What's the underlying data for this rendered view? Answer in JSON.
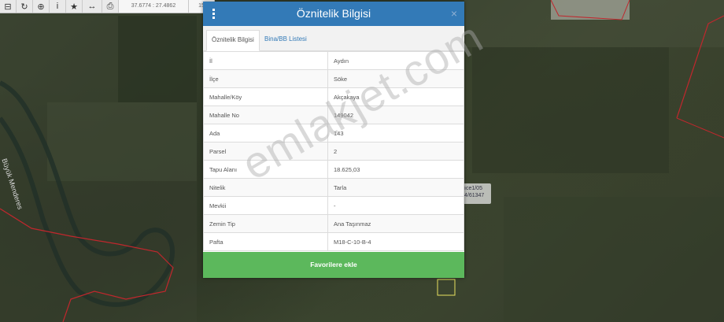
{
  "toolbar": {
    "buttons": [
      {
        "icon": "menu-icon",
        "glyph": "⊟"
      },
      {
        "icon": "refresh-icon",
        "glyph": "↻"
      },
      {
        "icon": "crosshair-icon",
        "glyph": "⊕"
      },
      {
        "icon": "info-icon",
        "glyph": "i"
      },
      {
        "icon": "star-icon",
        "glyph": "★"
      },
      {
        "icon": "measure-icon",
        "glyph": "↔"
      },
      {
        "icon": "print-icon",
        "glyph": "⎙"
      }
    ],
    "coordinates": "37.6774 : 27.4862",
    "zoom": "15"
  },
  "map": {
    "river_label": "Büyük Menderes",
    "parcel_tag": "ıce1/05\n4/61347"
  },
  "popup": {
    "title": "Öznitelik Bilgisi",
    "close_glyph": "×",
    "tabs": [
      {
        "label": "Öznitelik Bilgisi",
        "active": true
      },
      {
        "label": "Bina/BB Listesi",
        "active": false
      }
    ],
    "rows": [
      {
        "key": "İl",
        "value": "Aydın"
      },
      {
        "key": "İlçe",
        "value": "Söke"
      },
      {
        "key": "Mahalle/Köy",
        "value": "Akçakaya"
      },
      {
        "key": "Mahalle No",
        "value": "149042"
      },
      {
        "key": "Ada",
        "value": "143"
      },
      {
        "key": "Parsel",
        "value": "2"
      },
      {
        "key": "Tapu Alanı",
        "value": "18.625,03"
      },
      {
        "key": "Nitelik",
        "value": "Tarla"
      },
      {
        "key": "Mevkii",
        "value": "-"
      },
      {
        "key": "Zemin Tip",
        "value": "Ana Taşınmaz"
      },
      {
        "key": "Pafta",
        "value": "M18-C-10-B-4"
      }
    ],
    "favorite_button": "Favorilere ekle"
  },
  "watermark": "emlakjet.com",
  "colors": {
    "header": "#337ab7",
    "favorite": "#5cb85c",
    "parcel_border": "#c0272d"
  }
}
